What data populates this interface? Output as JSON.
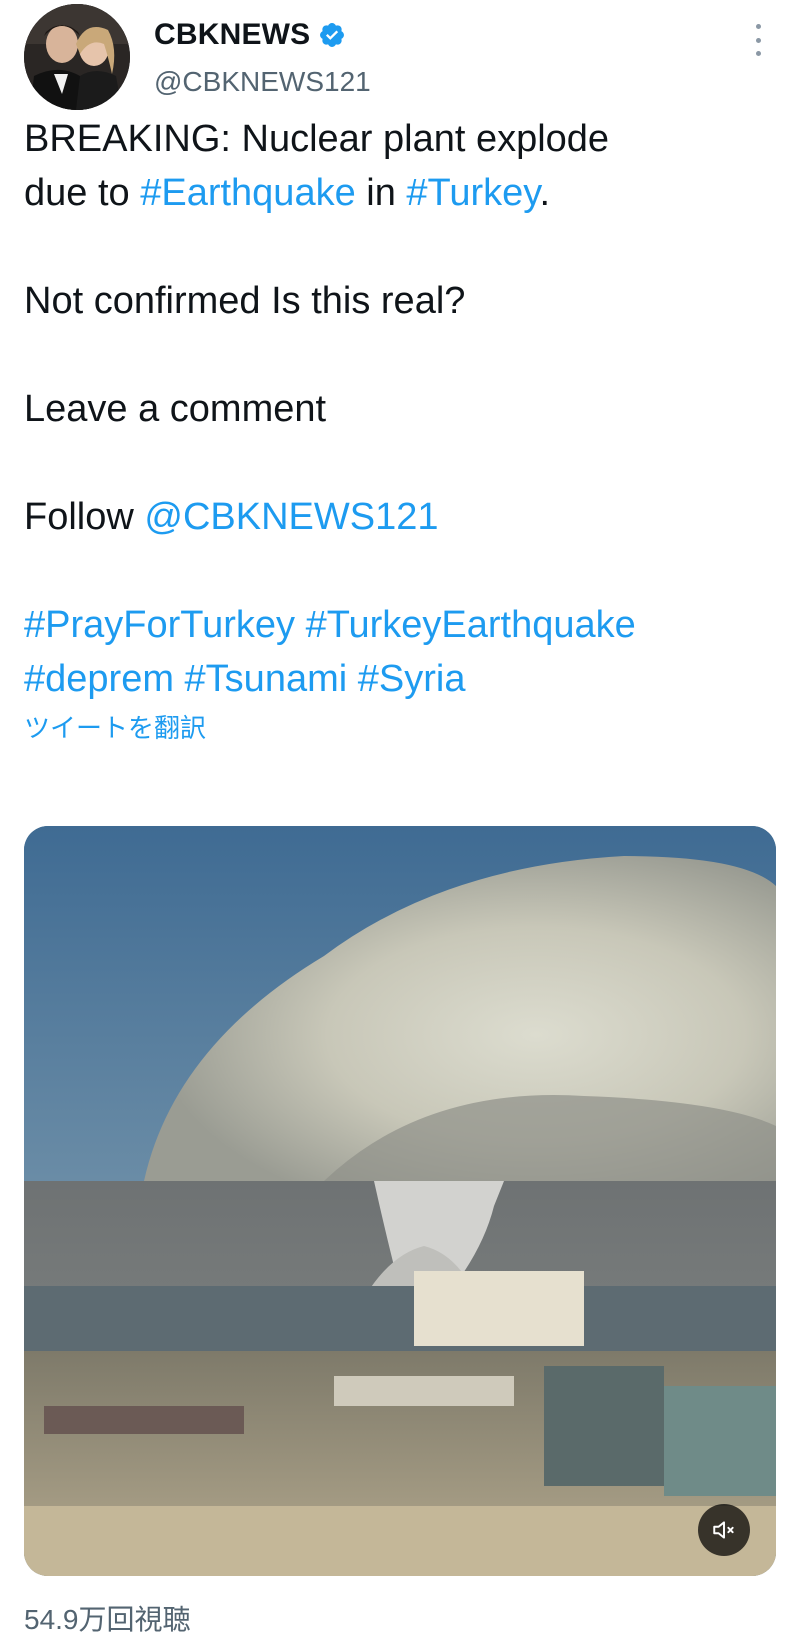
{
  "author": {
    "display_name": "CBKNEWS",
    "handle": "@CBKNEWS121",
    "verified": true,
    "avatar_icon": "profile-photo-avatar"
  },
  "tweet": {
    "line1_prefix": "BREAKING: Nuclear plant explode",
    "line2_prefix": "due to ",
    "hashtag_earthquake": "#Earthquake",
    "line2_mid": " in ",
    "hashtag_turkey": "#Turkey",
    "line2_suffix": ".",
    "paragraph2": "Not confirmed Is this real?",
    "paragraph3": "Leave a comment",
    "follow_prefix": "Follow ",
    "follow_mention": "@CBKNEWS121",
    "hashtags_line1": [
      "#PrayForTurkey",
      "#TurkeyEarthquake"
    ],
    "hashtags_line2": [
      "#deprem",
      "#Tsunami",
      "#Syria"
    ]
  },
  "translate_label": "ツイートを翻訳",
  "media": {
    "type": "video",
    "mute_icon": "speaker-muted-icon"
  },
  "views_label": "54.9万回視聴",
  "colors": {
    "link": "#1d9bf0",
    "text": "#0f1419",
    "secondary": "#536471",
    "verified": "#1d9bf0"
  }
}
